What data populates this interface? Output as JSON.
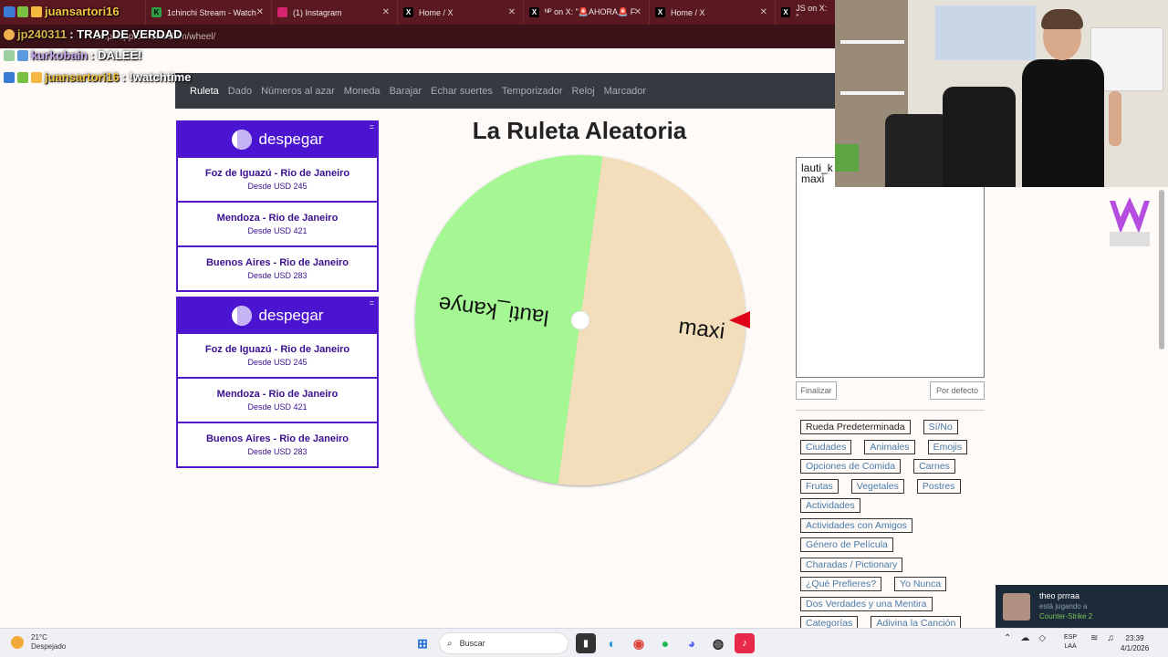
{
  "browser": {
    "tabs": [
      {
        "label": "1chinchi Stream - Watch",
        "icon_color": "#2ea043"
      },
      {
        "label": "(1) Instagram",
        "icon_color": "#d6246e"
      },
      {
        "label": "Home / X",
        "icon_color": "#000000"
      },
      {
        "label": "ᴺᴾ on X: \"🚨AHORA🚨 F",
        "icon_color": "#000000"
      },
      {
        "label": "Home / X",
        "icon_color": "#000000"
      },
      {
        "label": "JS on X: \"",
        "icon_color": "#000000"
      }
    ],
    "address": "es.piliapp.com/random/wheel/"
  },
  "chat": [
    {
      "user": "juansartori16",
      "msg": "",
      "color": "#f5c542"
    },
    {
      "user": "jp240311",
      "msg": ": TRAP DE VERDAD",
      "color": "#d8b04a"
    },
    {
      "user": "kurkobain",
      "msg": ": DALEE!",
      "color": "#c8a8f0"
    },
    {
      "user": "juansartori16",
      "msg": ": !watchtime",
      "color": "#f5c542"
    }
  ],
  "nav": {
    "items": [
      "Ruleta",
      "Dado",
      "Números al azar",
      "Moneda",
      "Barajar",
      "Echar suertes",
      "Temporizador",
      "Reloj",
      "Marcador"
    ],
    "active": "Ruleta"
  },
  "ads": [
    {
      "brand": "despegar",
      "menu": "=",
      "routes": [
        {
          "title": "Foz de Iguazú - Rio de Janeiro",
          "price": "Desde USD 245"
        },
        {
          "title": "Mendoza - Rio de Janeiro",
          "price": "Desde USD 421"
        },
        {
          "title": "Buenos Aires - Rio de Janeiro",
          "price": "Desde USD 283"
        }
      ]
    },
    {
      "brand": "despegar",
      "menu": "=",
      "routes": [
        {
          "title": "Foz de Iguazú - Rio de Janeiro",
          "price": "Desde USD 245"
        },
        {
          "title": "Mendoza - Rio de Janeiro",
          "price": "Desde USD 421"
        },
        {
          "title": "Buenos Aires - Rio de Janeiro",
          "price": "Desde USD 283"
        }
      ]
    }
  ],
  "page": {
    "title": "La Ruleta Aleatoria"
  },
  "wheel": {
    "segments": [
      {
        "label": "lauti_kanye",
        "color": "#a4f792"
      },
      {
        "label": "maxi",
        "color": "#f2deba"
      }
    ],
    "pointer_color": "#e0001a"
  },
  "editor": {
    "text": "lauti_k\nmaxi",
    "finish_label": "Finalizar",
    "default_label": "Por defecto"
  },
  "presets": [
    [
      "Rueda Predeterminada",
      "Sí/No"
    ],
    [
      "Ciudades",
      "Animales",
      "Emojis"
    ],
    [
      "Opciones de Comida",
      "Carnes"
    ],
    [
      "Frutas",
      "Vegetales",
      "Postres"
    ],
    [
      "Actividades"
    ],
    [
      "Actividades con Amigos"
    ],
    [
      "Género de Película"
    ],
    [
      "Charadas / Pictionary"
    ],
    [
      "¿Qué Prefieres?",
      "Yo Nunca"
    ],
    [
      "Dos Verdades y una Mentira"
    ],
    [
      "Categorías",
      "Adivina la Canción"
    ]
  ],
  "notification": {
    "name": "theo prrraa",
    "status": "está jugando a",
    "game": "Counter-Strike 2"
  },
  "taskbar": {
    "temp": "21°C",
    "weather": "Despejado",
    "search": "Buscar",
    "lang1": "ESP",
    "lang2": "LAA",
    "time": "23:39",
    "date": "4/1/2026"
  }
}
